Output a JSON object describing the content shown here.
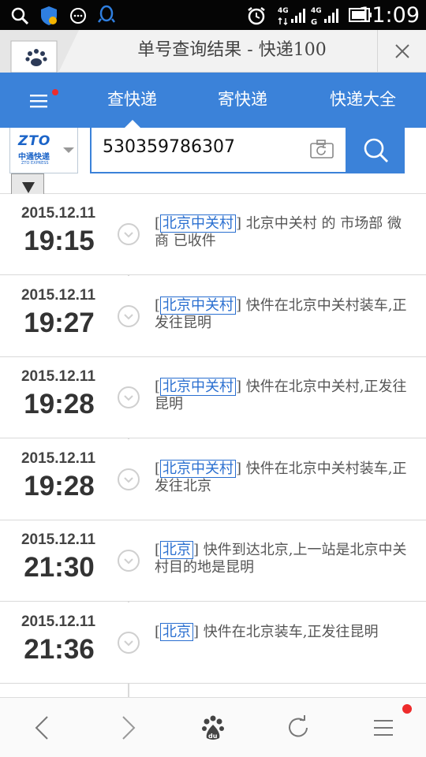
{
  "status_bar": {
    "time": "11:09",
    "network_1": "4G",
    "network_2": "4G"
  },
  "title_bar": {
    "title": "单号查询结果 - 快递100"
  },
  "nav": {
    "tabs": [
      {
        "label": "查快递",
        "active": true
      },
      {
        "label": "寄快递",
        "active": false
      },
      {
        "label": "快递大全",
        "active": false
      }
    ]
  },
  "courier": {
    "logo_text": "ZTO",
    "logo_cn": "中通快递",
    "logo_en": "ZTO EXPRESS"
  },
  "search": {
    "value": "530359786307"
  },
  "tracking": [
    {
      "date": "2015.12.11",
      "time": "19:15",
      "place": "北京中关村",
      "text": "北京中关村 的 市场部 微商 已收件"
    },
    {
      "date": "2015.12.11",
      "time": "19:27",
      "place": "北京中关村",
      "text": "快件在北京中关村装车,正发往昆明"
    },
    {
      "date": "2015.12.11",
      "time": "19:28",
      "place": "北京中关村",
      "text": "快件在北京中关村,正发往昆明"
    },
    {
      "date": "2015.12.11",
      "time": "19:28",
      "place": "北京中关村",
      "text": "快件在北京中关村装车,正发往北京"
    },
    {
      "date": "2015.12.11",
      "time": "21:30",
      "place": "北京",
      "text": "快件到达北京,上一站是北京中关村目的地是昆明"
    },
    {
      "date": "2015.12.11",
      "time": "21:36",
      "place": "北京",
      "text": "快件在北京装车,正发往昆明"
    }
  ],
  "colors": {
    "accent": "#3b82d9",
    "link": "#2a6fd0",
    "badge": "#ee2b2b"
  }
}
